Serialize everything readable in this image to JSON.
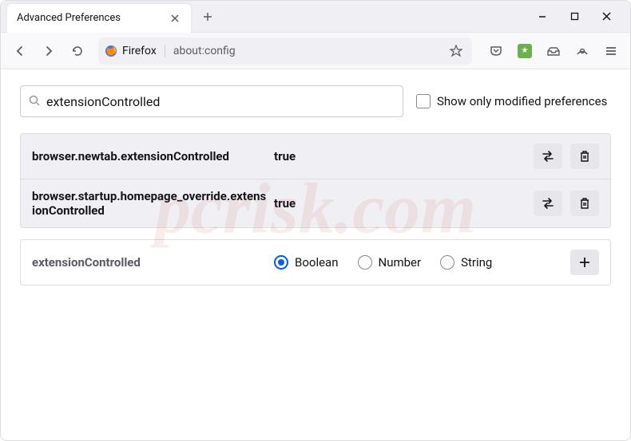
{
  "titlebar": {
    "tab_title": "Advanced Preferences"
  },
  "toolbar": {
    "identity_label": "Firefox",
    "url": "about:config"
  },
  "search": {
    "value": "extensionControlled",
    "checkbox_label": "Show only modified preferences"
  },
  "prefs": [
    {
      "name": "browser.newtab.extensionControlled",
      "value": "true"
    },
    {
      "name": "browser.startup.homepage_override.extensionControlled",
      "value": "true"
    }
  ],
  "new_pref": {
    "name": "extensionControlled",
    "types": [
      "Boolean",
      "Number",
      "String"
    ],
    "selected": 0
  },
  "watermark": "pcrisk.com"
}
